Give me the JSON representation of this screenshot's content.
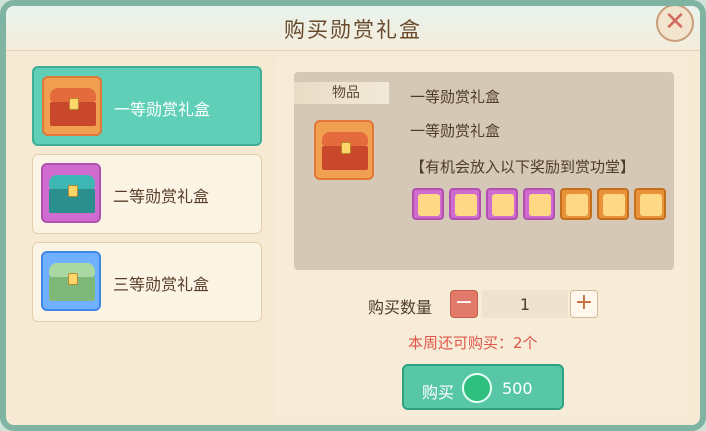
{
  "dialog": {
    "title": "购买勋赏礼盒",
    "close_label": "✕"
  },
  "items": [
    {
      "label": "一等勋赏礼盒",
      "colors": {
        "icon_bg": "#f0a050",
        "icon_border": "#e0783a",
        "lid": "#e46b3b",
        "body": "#c9482c"
      }
    },
    {
      "label": "二等勋赏礼盒",
      "colors": {
        "icon_bg": "#d06ccf",
        "icon_border": "#b34fb1",
        "lid": "#3cb7b4",
        "body": "#2a8f8d"
      }
    },
    {
      "label": "三等勋赏礼盒",
      "colors": {
        "icon_bg": "#6fb0ff",
        "icon_border": "#3f87e6",
        "lid": "#a9d8a2",
        "body": "#7fb97a"
      }
    }
  ],
  "detail": {
    "tag_label": "物品",
    "name_line_1": "一等勋赏礼盒",
    "name_line_2": "一等勋赏礼盒",
    "reward_line": "【有机会放入以下奖励到赏功堂】",
    "rewards": [
      {
        "name": "reward-icon-1",
        "rarity": "purple"
      },
      {
        "name": "reward-icon-2",
        "rarity": "purple"
      },
      {
        "name": "reward-icon-3",
        "rarity": "purple"
      },
      {
        "name": "reward-icon-4",
        "rarity": "purple"
      },
      {
        "name": "reward-icon-5",
        "rarity": "orange"
      },
      {
        "name": "reward-icon-6",
        "rarity": "orange"
      },
      {
        "name": "reward-icon-7",
        "rarity": "orange"
      }
    ]
  },
  "purchase": {
    "qty_label": "购买数量",
    "qty_value": "1",
    "minus_label": "−",
    "plus_label": "+",
    "limit_text": "本周还可购买：2个",
    "buy_label": "购买",
    "price": "500"
  }
}
